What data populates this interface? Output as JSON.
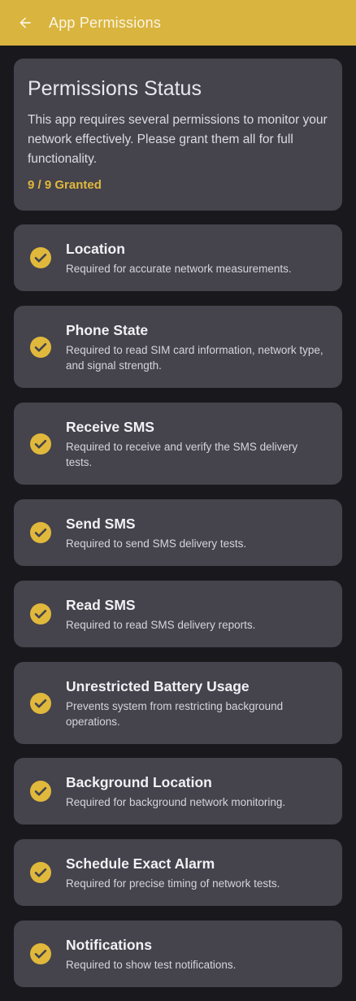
{
  "appbar": {
    "title": "App Permissions",
    "back_icon": "arrow-back-icon",
    "color": "#d9b43e"
  },
  "status": {
    "title": "Permissions Status",
    "description": "This app requires several permissions to monitor your network effectively. Please grant them all for full functionality.",
    "granted_text": "9 / 9 Granted",
    "granted_color": "#e0b93c"
  },
  "permissions": [
    {
      "title": "Location",
      "description": "Required for accurate network measurements.",
      "granted": true,
      "icon": "check-circle-icon"
    },
    {
      "title": "Phone State",
      "description": "Required to read SIM card information, network type, and signal strength.",
      "granted": true,
      "icon": "check-circle-icon"
    },
    {
      "title": "Receive SMS",
      "description": "Required to receive and verify the SMS delivery tests.",
      "granted": true,
      "icon": "check-circle-icon"
    },
    {
      "title": "Send SMS",
      "description": "Required to send SMS delivery tests.",
      "granted": true,
      "icon": "check-circle-icon"
    },
    {
      "title": "Read SMS",
      "description": "Required to read SMS delivery reports.",
      "granted": true,
      "icon": "check-circle-icon"
    },
    {
      "title": "Unrestricted Battery Usage",
      "description": "Prevents system from restricting background operations.",
      "granted": true,
      "icon": "check-circle-icon"
    },
    {
      "title": "Background Location",
      "description": "Required for background network monitoring.",
      "granted": true,
      "icon": "check-circle-icon"
    },
    {
      "title": "Schedule Exact Alarm",
      "description": "Required for precise timing of network tests.",
      "granted": true,
      "icon": "check-circle-icon"
    },
    {
      "title": "Notifications",
      "description": "Required to show test notifications.",
      "granted": true,
      "icon": "check-circle-icon"
    }
  ]
}
